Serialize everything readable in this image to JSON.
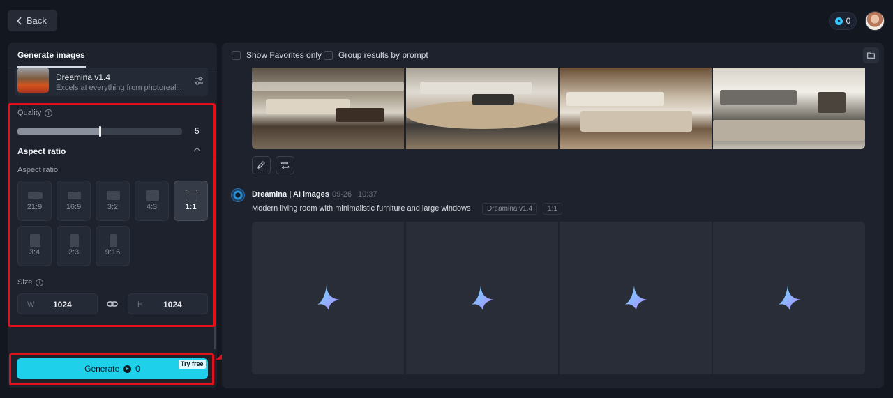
{
  "header": {
    "back_label": "Back",
    "credits": "0"
  },
  "left_panel": {
    "tab_title": "Generate images",
    "model": {
      "name": "Dreamina v1.4",
      "description": "Excels at everything from photoreali..."
    },
    "quality": {
      "label": "Quality",
      "value": "5",
      "fraction": 0.5
    },
    "aspect_section": {
      "heading": "Aspect ratio",
      "label": "Aspect ratio",
      "options": [
        "21:9",
        "16:9",
        "3:2",
        "4:3",
        "1:1",
        "3:4",
        "2:3",
        "9:16"
      ],
      "selected": "1:1"
    },
    "size": {
      "label": "Size",
      "width_prefix": "W",
      "width_value": "1024",
      "height_prefix": "H",
      "height_value": "1024"
    },
    "generate": {
      "label": "Generate",
      "cost": "0",
      "badge": "Try free"
    }
  },
  "right_panel": {
    "show_favorites_label": "Show Favorites only",
    "group_results_label": "Group results by prompt",
    "feed": {
      "author": "Dreamina | AI images",
      "date": "09-26",
      "time": "10:37",
      "prompt": "Modern living room with minimalistic furniture and large windows",
      "tags": [
        "Dreamina v1.4",
        "1:1"
      ]
    }
  },
  "colors": {
    "accent": "#1fd0ea",
    "annotation": "#e3101b",
    "background": "#131720",
    "panel": "#1d222c"
  },
  "icons": [
    "chevron-left-icon",
    "credit-coin-icon",
    "settings-sliders-icon",
    "info-icon",
    "chevron-up-icon",
    "link-icon",
    "folder-icon",
    "edit-pencil-icon",
    "regenerate-icon",
    "dreamina-spark-icon"
  ]
}
